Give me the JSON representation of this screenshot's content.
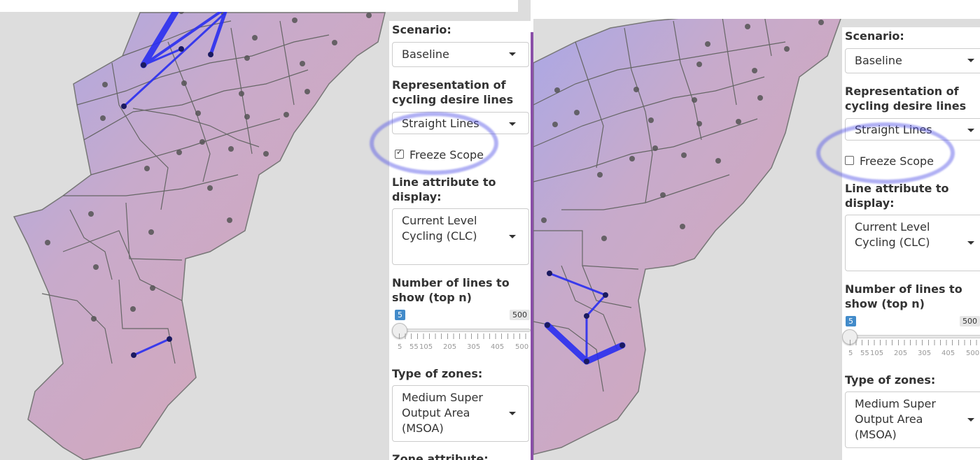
{
  "left": {
    "scenario_label": "Scenario:",
    "scenario_value": "Baseline",
    "representation_label": "Representation of cycling desire lines",
    "representation_value": "Straight Lines",
    "freeze_label": "Freeze Scope",
    "freeze_checked": true,
    "line_attr_label": "Line attribute to display:",
    "line_attr_value": "Current Level Cycling (CLC)",
    "num_lines_label": "Number of lines to show (top n)",
    "slider_value": "5",
    "slider_max": "500",
    "slider_ticks": [
      "5",
      "55",
      "105",
      "205",
      "305",
      "405",
      "500"
    ],
    "zones_label": "Type of zones:",
    "zones_value": "Medium Super Output Area (MSOA)",
    "zone_attr_label": "Zone attribute:"
  },
  "right": {
    "scenario_label": "Scenario:",
    "scenario_value": "Baseline",
    "representation_label": "Representation of cycling desire lines",
    "representation_value": "Straight Lines",
    "freeze_label": "Freeze Scope",
    "freeze_checked": false,
    "line_attr_label": "Line attribute to display:",
    "line_attr_value": "Current Level Cycling (CLC)",
    "num_lines_label": "Number of lines to show (top n)",
    "slider_value": "5",
    "slider_max": "500",
    "slider_ticks": [
      "5",
      "55",
      "105",
      "205",
      "305",
      "405",
      "500"
    ],
    "zones_label": "Type of zones:",
    "zones_value": "Medium Super Output Area (MSOA)"
  },
  "colors": {
    "desire_line": "#2a2ef0",
    "zone_fill_pink": "#d3a9b7",
    "zone_fill_blue": "#b0aee0",
    "annotation": "#5050e6"
  }
}
